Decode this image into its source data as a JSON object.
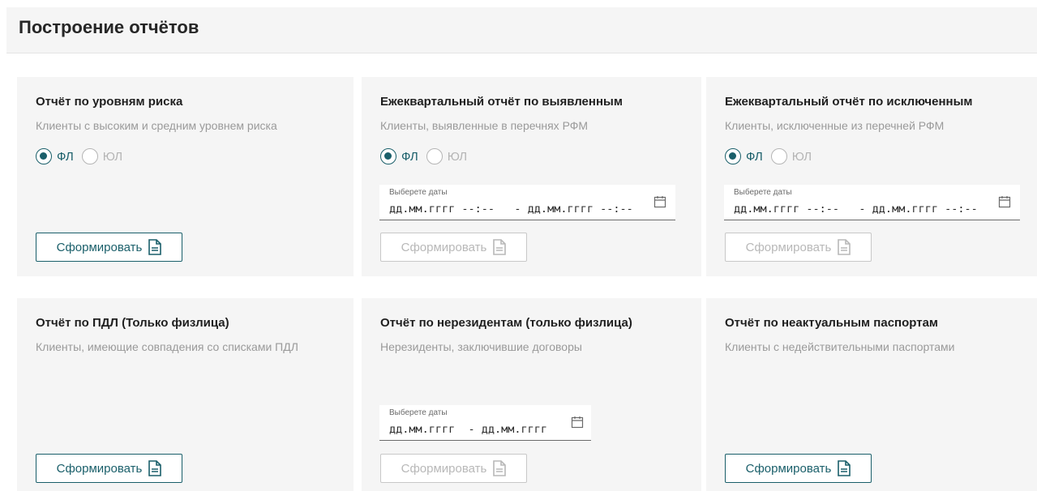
{
  "page": {
    "title": "Построение отчётов"
  },
  "labels": {
    "button": "Сформировать",
    "date_caption": "Выберете даты",
    "radio_fl": "ФЛ",
    "radio_ul": "ЮЛ"
  },
  "cards": [
    {
      "title": "Отчёт по уровням риска",
      "description": "Клиенты с высоким и средним уровнем риска",
      "selected": "ФЛ",
      "button_enabled": true
    },
    {
      "title": "Ежеквартальный отчёт по выявленным",
      "description": "Клиенты, выявленные в перечнях РФМ",
      "selected": "ФЛ",
      "date_value": "дд.мм.гггг --:--   - дд.мм.гггг --:--",
      "button_enabled": false
    },
    {
      "title": "Ежеквартальный отчёт по исключенным",
      "description": "Клиенты, исключенные из перечней РФМ",
      "selected": "ФЛ",
      "date_value": "дд.мм.гггг --:--   - дд.мм.гггг --:--",
      "button_enabled": false
    },
    {
      "title": "Отчёт по ПДЛ (Только физлица)",
      "description": "Клиенты, имеющие совпадения со списками ПДЛ",
      "button_enabled": true
    },
    {
      "title": "Отчёт по нерезидентам (только физлица)",
      "description": "Нерезиденты, заключившие договоры",
      "date_value": "дд.мм.гггг  - дд.мм.гггг",
      "button_enabled": false
    },
    {
      "title": "Отчёт по неактуальным паспортам",
      "description": "Клиенты с недействительными паспортами",
      "button_enabled": true
    }
  ],
  "colors": {
    "accent": "#1a5f6a",
    "card_bg": "#f5f5f5",
    "muted_text": "#9a9a9a",
    "disabled": "#c8c8c8"
  }
}
